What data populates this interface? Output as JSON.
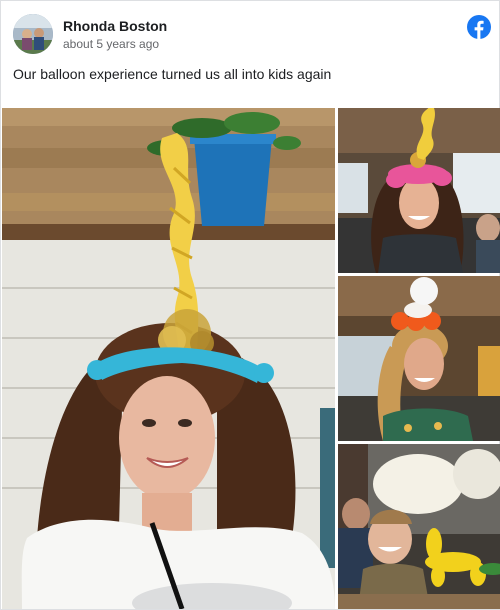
{
  "post": {
    "author": "Rhonda Boston",
    "timestamp": "about 5 years ago",
    "caption": "Our balloon experience turned us all into kids again"
  },
  "icons": {
    "platform_logo": "facebook-logo-icon"
  },
  "colors": {
    "facebook_blue": "#1877f2",
    "author_text": "#1c1e21",
    "secondary_text": "#65676b",
    "border": "#dddfe2"
  },
  "photos": [
    {
      "id": "main",
      "subject": "woman-with-unicorn-balloon-hat"
    },
    {
      "id": "right-1",
      "subject": "woman-with-pink-balloon-hat"
    },
    {
      "id": "right-2",
      "subject": "woman-with-balloon-tower-hat"
    },
    {
      "id": "right-3",
      "subject": "child-with-yellow-balloon-animal"
    }
  ]
}
